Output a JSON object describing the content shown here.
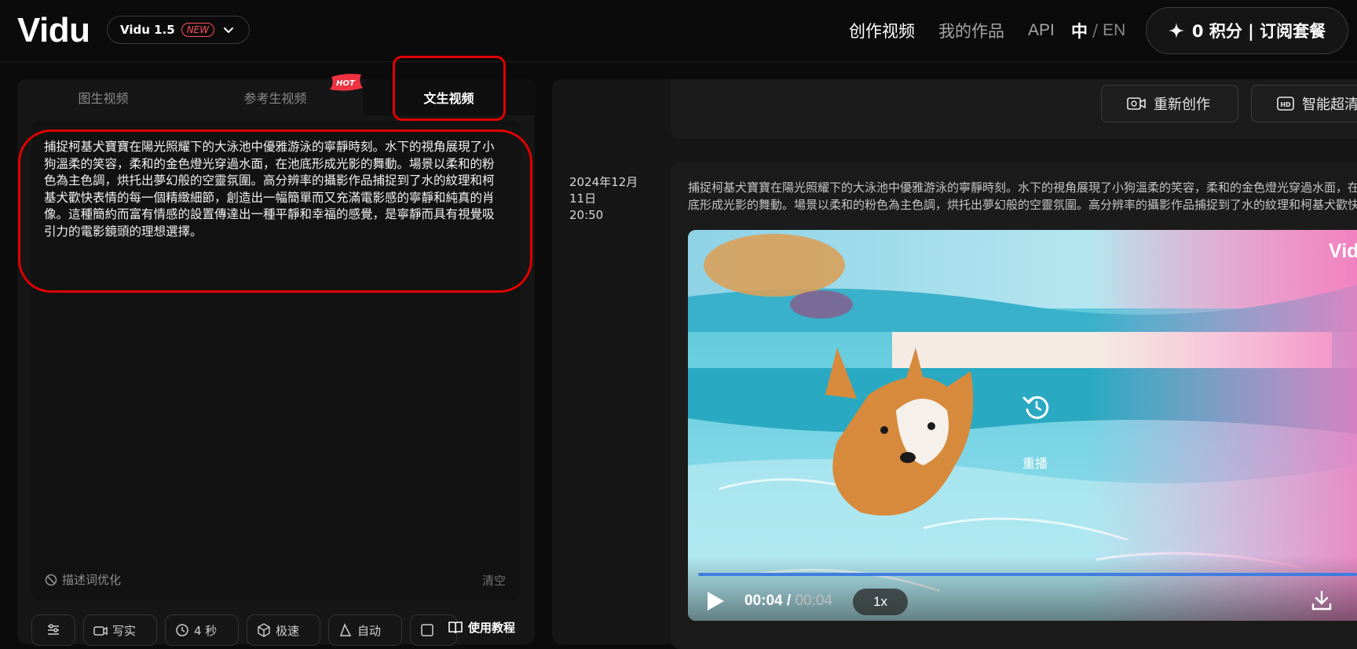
{
  "header": {
    "logo": "Vidu",
    "model": {
      "name": "Vidu 1.5",
      "badge": "NEW"
    },
    "nav": {
      "create": "创作视频",
      "works": "我的作品",
      "api": "API"
    },
    "lang": {
      "zh": "中",
      "sep": "/",
      "en": "EN"
    },
    "credits_label": "0 积分 | 订阅套餐"
  },
  "tabs": [
    {
      "label": "图生视频"
    },
    {
      "label": "参考生视频",
      "badge": "HOT"
    },
    {
      "label": "文生视频",
      "active": true
    }
  ],
  "prompt": {
    "text": "捕捉柯基犬寶寶在陽光照耀下的大泳池中優雅游泳的寧靜時刻。水下的視角展現了小狗溫柔的笑容，柔和的金色燈光穿過水面，在池底形成光影的舞動。場景以柔和的粉色為主色調，烘托出夢幻般的空靈氛圍。高分辨率的攝影作品捕捉到了水的紋理和柯基犬歡快表情的每一個精緻細節，創造出一幅簡單而又充滿電影感的寧靜和純真的肖像。這種簡約而富有情感的設置傳達出一種平靜和幸福的感覺，是寧靜而具有視覺吸引力的電影鏡頭的理想選擇。",
    "optimize_label": "描述词优化",
    "clear_label": "清空"
  },
  "options": {
    "style": "写实",
    "duration": "4 秒",
    "speed": "极速",
    "ratio": "自动",
    "tutorial": "使用教程"
  },
  "result": {
    "actions": {
      "recreate": "重新创作",
      "upscale": "智能超清"
    },
    "date": "2024年12月11日",
    "time": "20:50",
    "prompt_line1": "捕捉柯基犬寶寶在陽光照耀下的大泳池中優雅游泳的寧靜時刻。水下的視角展現了小狗溫柔的笑容，柔和的金色燈光穿過水面，在池",
    "prompt_line2": "底形成光影的舞動。場景以柔和的粉色為主色調，烘托出夢幻般的空靈氛圍。高分辨率的攝影作品捕捉到了水的紋理和柯基犬歡快表",
    "video": {
      "watermark": "Vidu",
      "replay_label": "重播",
      "current_time": "00:04",
      "time_sep": "/",
      "duration": "00:04",
      "speed": "1x",
      "progress": 1.0
    }
  },
  "colors": {
    "accent_red": "#e00000",
    "progress_blue": "#3f7de0",
    "new_badge": "#ff4d5a"
  }
}
